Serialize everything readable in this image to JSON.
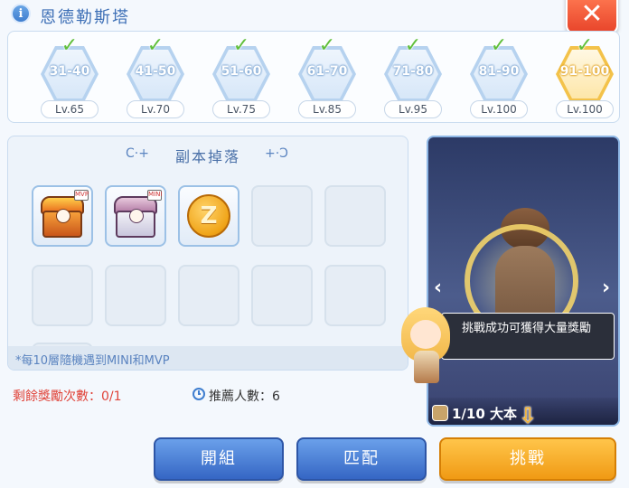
{
  "header": {
    "info_icon": "i",
    "title": "恩德勒斯塔",
    "close_icon": "✕"
  },
  "levels": [
    {
      "range": "31-40",
      "lv": "Lv.65",
      "cleared": true
    },
    {
      "range": "41-50",
      "lv": "Lv.70",
      "cleared": true
    },
    {
      "range": "51-60",
      "lv": "Lv.75",
      "cleared": true
    },
    {
      "range": "61-70",
      "lv": "Lv.85",
      "cleared": true
    },
    {
      "range": "71-80",
      "lv": "Lv.95",
      "cleared": true
    },
    {
      "range": "81-90",
      "lv": "Lv.100",
      "cleared": true
    },
    {
      "range": "91-100",
      "lv": "Lv.100",
      "cleared": true,
      "selected": true
    }
  ],
  "check_icon": "✓",
  "drops": {
    "title": "副本掉落",
    "deco_left": "C·+",
    "deco_right": "+·Ɔ",
    "items": [
      "mvp-chest",
      "mini-chest",
      "zeny-coin"
    ],
    "coin_letter": "Z",
    "mini_badge_1": "MVP",
    "mini_badge_2": "MINI",
    "note": "*每10層隨機遇到MINI和MVP"
  },
  "info": {
    "reward_count": "剩餘獎勵次數：0/1",
    "recommend": "推薦人數：6"
  },
  "preview": {
    "counter": "1/10 大本",
    "left_arrow": "‹",
    "right_arrow": "›"
  },
  "npc_speech": "挑戰成功可獲得大量獎勵",
  "down_arrow": "⇩",
  "buttons": {
    "team": "開組",
    "match": "匹配",
    "challenge": "挑戰"
  },
  "colors": {
    "accent_blue": "#3f7ecf",
    "close_red": "#e8442a",
    "challenge_orange": "#f09a14",
    "reward_red": "#e0443a"
  }
}
